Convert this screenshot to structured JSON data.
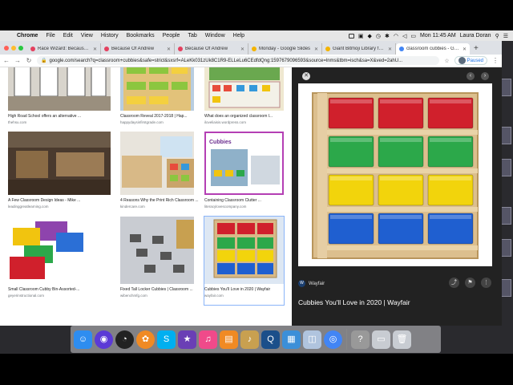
{
  "menubar": {
    "items": [
      "Chrome",
      "File",
      "Edit",
      "View",
      "History",
      "Bookmarks",
      "People",
      "Tab",
      "Window",
      "Help"
    ],
    "clock": "Mon 11:45 AM",
    "user": "Laura Doran"
  },
  "tabs": [
    {
      "label": "Race Wizard: Because Of",
      "color": "#e4405f"
    },
    {
      "label": "Because Of Andrew",
      "color": "#e4405f"
    },
    {
      "label": "Because Of Andrew",
      "color": "#e4405f"
    },
    {
      "label": "Monday - Google Slides",
      "color": "#f4b400"
    },
    {
      "label": "Giant Bitmoji Library for E",
      "color": "#f4b400"
    },
    {
      "label": "classroom cubbies - Goog",
      "color": "#4285f4",
      "active": true
    }
  ],
  "address": {
    "url": "google.com/search?q=classroom+cubbies&safe=strict&sxsrf=ALeKk031zUk8C1R9-ELLeLu6CEdfdQng:1597679096593&source=lnms&tbm=isch&sa=X&ved=2ahU...",
    "paused_label": "Paused"
  },
  "results": [
    {
      "title": "High Road School offers an alternative ...",
      "source": "thehsu.com"
    },
    {
      "title": "Classroom Reveal 2017-2018 | Hap...",
      "source": "happydaysinfirstgrade.com"
    },
    {
      "title": "What does an organized classroom l...",
      "source": "iloveliaisis.wordpress.com"
    },
    {
      "title": "A Few Classroom Design Ideas - Mike ...",
      "source": "leadinggreatlearning.com"
    },
    {
      "title": "4 Reasons Why the Print Rich Classroom ...",
      "source": "kindercare.com"
    },
    {
      "title": "Containing Classroom Clutter ...",
      "source": "literacylovescompany.com"
    },
    {
      "title": "Small Classroom Cubby Bin-Assorted-...",
      "source": "geyerinstructional.com"
    },
    {
      "title": "Fixed Tall Locker Cubbies | Classroom ...",
      "source": "wibenchmfg.com"
    },
    {
      "title": "Cubbies You'll Love in 2020 | Wayfair",
      "source": "wayfair.com"
    }
  ],
  "thumb_overlay": "Cubbies",
  "preview": {
    "source": "Wayfair",
    "title": "Cubbies You'll Love in 2020 | Wayfair",
    "bin_colors": [
      "#d0202c",
      "#2ca84a",
      "#f2d40c",
      "#1f5fd0"
    ]
  },
  "dock": [
    {
      "name": "finder-icon",
      "glyph": "☺",
      "color": "#2e8df0"
    },
    {
      "name": "siri-icon",
      "glyph": "◉",
      "color": "#5b3ad6"
    },
    {
      "name": "dashboard-icon",
      "glyph": "◔",
      "color": "#222"
    },
    {
      "name": "photos-icon",
      "glyph": "✿",
      "color": "#f08a24"
    },
    {
      "name": "skype-icon",
      "glyph": "S",
      "color": "#00aff0"
    },
    {
      "name": "imovie-icon",
      "glyph": "★",
      "color": "#6a3fb5"
    },
    {
      "name": "itunes-icon",
      "glyph": "♫",
      "color": "#f04a8a"
    },
    {
      "name": "ibooks-icon",
      "glyph": "▤",
      "color": "#f08a24"
    },
    {
      "name": "garageband-icon",
      "glyph": "♪",
      "color": "#c8a050"
    },
    {
      "name": "quicktime-icon",
      "glyph": "Q",
      "color": "#1b4f8a"
    },
    {
      "name": "preview-icon",
      "glyph": "▦",
      "color": "#3c8fd8"
    },
    {
      "name": "photobooth-icon",
      "glyph": "◫",
      "color": "#b0c4de"
    },
    {
      "name": "chrome-icon",
      "glyph": "◎",
      "color": "#4285f4"
    },
    {
      "name": "help-icon",
      "glyph": "?",
      "color": "#999"
    },
    {
      "name": "downloads-icon",
      "glyph": "▭",
      "color": "#c8ccd2"
    },
    {
      "name": "trash-icon",
      "glyph": "🗑",
      "color": "#c8ccd2"
    }
  ]
}
